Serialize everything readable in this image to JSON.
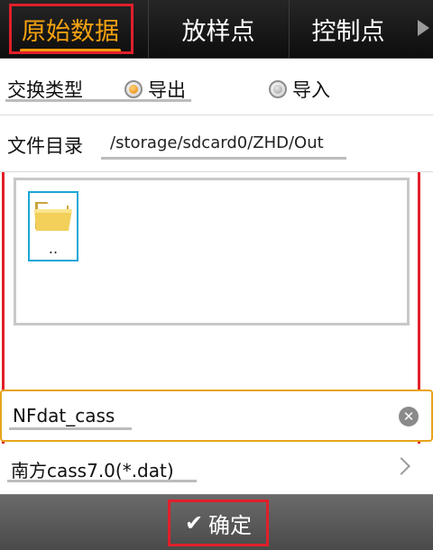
{
  "tabs": [
    {
      "label": "原始数据",
      "active": true
    },
    {
      "label": "放样点",
      "active": false
    },
    {
      "label": "控制点",
      "active": false
    }
  ],
  "exchange_type": {
    "label": "交换类型",
    "options": [
      {
        "label": "导出",
        "selected": true
      },
      {
        "label": "导入",
        "selected": false
      }
    ]
  },
  "directory": {
    "label": "文件目录",
    "path": "/storage/sdcard0/ZHD/Out"
  },
  "file_browser": {
    "items": [
      {
        "label": "..",
        "icon": "folder-icon"
      }
    ]
  },
  "filename": {
    "value": "NFdat_cass",
    "clear_icon": "clear-icon"
  },
  "format": {
    "value": "南方cass7.0(*.dat)"
  },
  "confirm": {
    "label": "确定",
    "icon": "check-icon"
  },
  "colors": {
    "accent": "#f29a0c",
    "highlight_box": "#e0202a",
    "selection": "#1aa6d8",
    "input_focus": "#e7a41a"
  }
}
